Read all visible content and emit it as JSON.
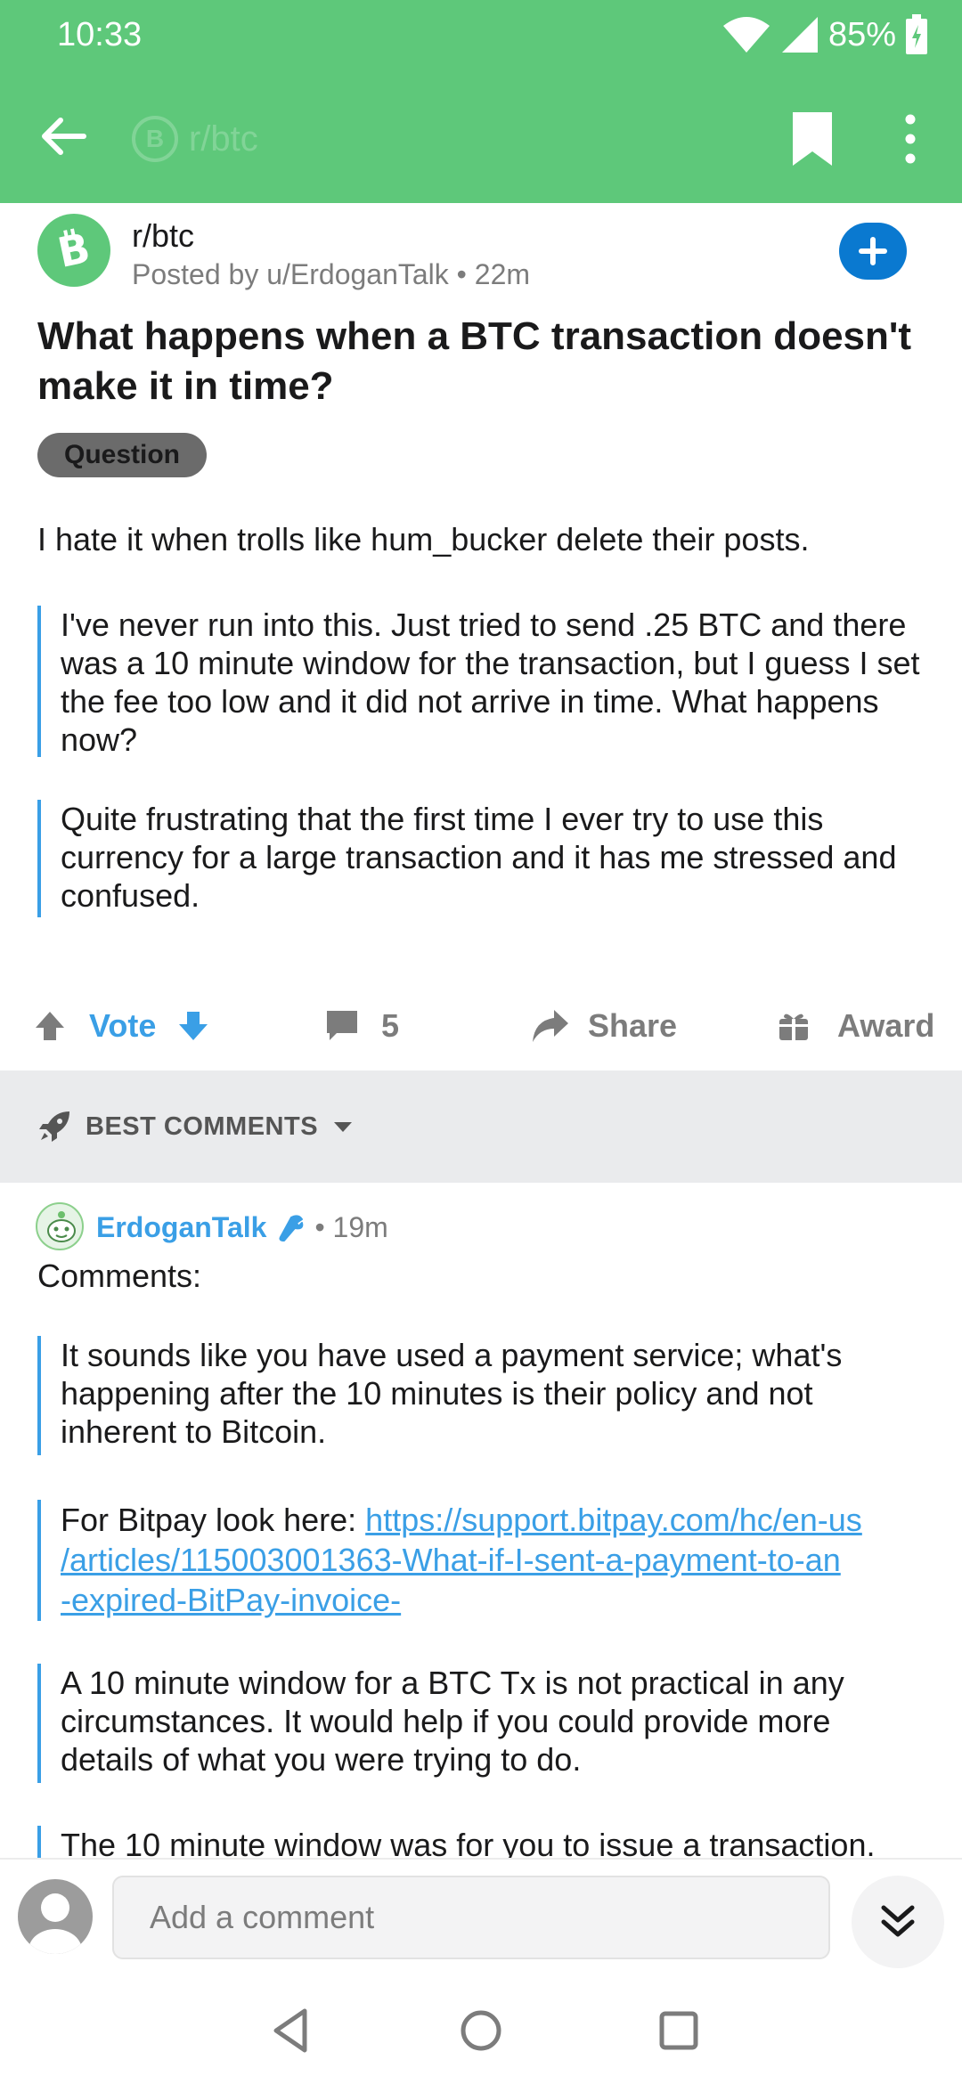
{
  "status_bar": {
    "time": "10:33",
    "battery": "85%"
  },
  "app_bar": {
    "subreddit_ghost": "r/btc",
    "ghost_logo": "B"
  },
  "post": {
    "subreddit": "r/btc",
    "meta": "Posted by u/ErdoganTalk • 22m",
    "title": "What happens when a BTC transaction doesn't make it in time?",
    "flair": "Question",
    "body": "I hate it when trolls like  hum_bucker delete their posts.",
    "quotes": [
      "I've never run into this. Just tried to send .25 BTC and there was a 10 minute window for the transaction, but I guess I set the fee too low and it did not arrive in time. What happens now?",
      "Quite frustrating that the first time I ever try to use this currency for a large transaction and it has me stressed and confused."
    ]
  },
  "actions": {
    "vote_label": "Vote",
    "comments_count": "5",
    "share_label": "Share",
    "award_label": "Award"
  },
  "sort": {
    "label": "BEST COMMENTS"
  },
  "comment": {
    "author": "ErdoganTalk",
    "time": "• 19m",
    "intro": "Comments:",
    "quote1": "It sounds like you have used a payment service; what's happening after the 10 minutes is their policy and not inherent to Bitcoin.",
    "quote2_prefix": "For Bitpay look here: ",
    "quote2_link_line1": "https://support.bitpay.com/hc/en-us",
    "quote2_link_line2": "/articles/115003001363-What-if-I-sent-a-payment-to-an",
    "quote2_link_line3": "-expired-BitPay-invoice-",
    "quote3": "A 10 minute window for a BTC Tx is not practical in any circumstances. It would help if you could provide more details of what you were trying to do.",
    "quote4": "The 10 minute window was for you to issue a transaction."
  },
  "reply": {
    "placeholder": "Add a comment"
  },
  "colors": {
    "app_bar": "#5ec87a",
    "accent_blue": "#3a9fe6",
    "join_button": "#0a79d0",
    "sort_band": "#eaebed"
  },
  "icons": [
    "back-arrow-icon",
    "bookmark-icon",
    "more-vertical-icon",
    "bitcoin-icon",
    "plus-icon",
    "upvote-icon",
    "downvote-icon",
    "comment-icon",
    "share-icon",
    "award-icon",
    "rocket-icon",
    "caret-down-icon",
    "moderator-wrench-icon",
    "chevron-double-down-icon",
    "back-triangle-icon",
    "home-circle-icon",
    "recents-square-icon"
  ]
}
